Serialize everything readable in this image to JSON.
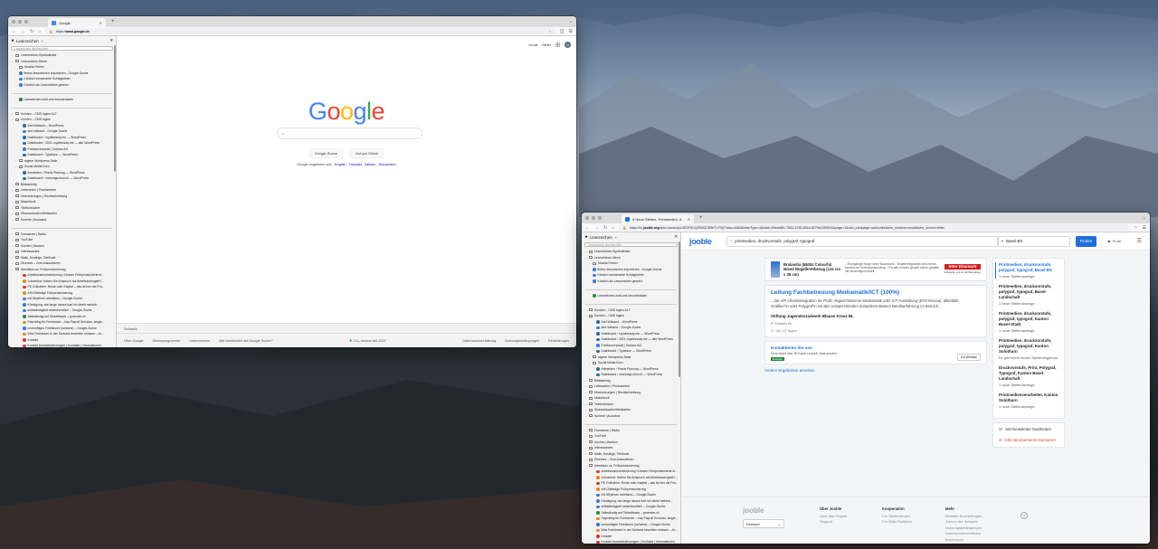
{
  "left_window": {
    "tab_title": "Google",
    "url_host": "www.google.ch",
    "url_prefix": "https://",
    "sidebar": {
      "title": "Lesezeichen",
      "search_placeholder": "Lesezeichen durchsuchen",
      "items": [
        {
          "label": "Lesezeichen-Symbolleiste",
          "type": "folder",
          "twisty": "›"
        },
        {
          "label": "Lesezeichen-Menü",
          "type": "folder",
          "twisty": "⌄"
        },
        {
          "label": "Mozilla Firefox",
          "type": "folder",
          "twisty": "›",
          "indent": 1
        },
        {
          "label": "firefox-lesezeichen importieren - Google-Suche",
          "type": "bm",
          "indent": 1
        },
        {
          "label": "Kürzlich verwendete Schlagwörter",
          "type": "bm",
          "indent": 1
        },
        {
          "label": "Kürzlich als Lesezeichen gesetzt",
          "type": "bm",
          "indent": 1
        },
        {
          "label": "",
          "type": "sep"
        },
        {
          "label": "Lesezeichen-Add-ons herunterladen",
          "type": "bm",
          "color": "g",
          "indent": 1
        },
        {
          "label": "",
          "type": "sep"
        },
        {
          "label": "Kunden – CMS logins ALT",
          "type": "folder",
          "twisty": "›"
        },
        {
          "label": "Kunden – CMS logins",
          "type": "folder",
          "twisty": "⌄"
        },
        {
          "label": "Ahrt Wieland – WordPress",
          "type": "bm",
          "color": "wp",
          "indent": 2
        },
        {
          "label": "ahrt wieland – Google-Suche",
          "type": "bm",
          "indent": 2
        },
        {
          "label": "Dashboard ‹ royalbeauty.me — WordPress",
          "type": "bm",
          "color": "wp",
          "indent": 2
        },
        {
          "label": "Dashboard ‹ 2021.royalbeauty.me — alte WordPress",
          "type": "bm",
          "color": "wp",
          "indent": 2
        },
        {
          "label": "Freelancerportal | Dorlasc AG",
          "type": "bm",
          "indent": 2
        },
        {
          "label": "Dashboard ‹ Typeface — WordPress",
          "type": "bm",
          "color": "wp",
          "indent": 2
        },
        {
          "label": "eigene Wordpress-Seite",
          "type": "folder",
          "twisty": "›",
          "indent": 1
        },
        {
          "label": "Social Media Koro",
          "type": "folder",
          "twisty": "›",
          "indent": 1
        },
        {
          "label": "Anmelden ‹ Praxis Planung — WordPress",
          "type": "bm",
          "color": "wp",
          "indent": 2
        },
        {
          "label": "Dashboard ‹ ordnungs-sinn.ch — WordPress",
          "type": "bm",
          "color": "wp",
          "indent": 2
        },
        {
          "label": "Bildbanking",
          "type": "folder",
          "twisty": "›"
        },
        {
          "label": "Lieferanten | Produzenten",
          "type": "folder",
          "twisty": "›"
        },
        {
          "label": "Übersetzungen | Rechtschreibung",
          "type": "folder",
          "twisty": "›"
        },
        {
          "label": "Maschtoolt",
          "type": "folder",
          "twisty": "›"
        },
        {
          "label": "Telefonbücher",
          "type": "folder",
          "twisty": "›"
        },
        {
          "label": "Strassenkarten/Webkarten",
          "type": "folder",
          "twisty": "›"
        },
        {
          "label": "Kurierie | Auswand",
          "type": "folder",
          "twisty": "›"
        },
        {
          "label": "",
          "type": "sep"
        },
        {
          "label": "Fernsehen | Radio",
          "type": "folder",
          "twisty": "›"
        },
        {
          "label": "YouTube",
          "type": "folder",
          "twisty": "›"
        },
        {
          "label": "Kochen | Backen",
          "type": "folder",
          "twisty": "›"
        },
        {
          "label": "Interessantes",
          "type": "folder",
          "twisty": "›"
        },
        {
          "label": "Mails, Hostings, Telefonie",
          "type": "folder",
          "twisty": "›"
        },
        {
          "label": "Diverses – Zum Aussortieren",
          "type": "folder",
          "twisty": "›"
        },
        {
          "label": "Arbeitslos ca. Frühpensionierung",
          "type": "folder",
          "twisty": "⌄"
        },
        {
          "label": "Arbeitslosenversicherung: Können Frühpensionierte ei...",
          "type": "bm",
          "color": "r",
          "indent": 2
        },
        {
          "label": "Jobverlust: Haben Sie Anspruch auf Arbeitslosengeld?...",
          "type": "bm",
          "color": "o",
          "indent": 2
        },
        {
          "label": "PK Guthaben: Rente oder Kapital – das ist hier die Fra...",
          "type": "bm",
          "color": "r",
          "indent": 2
        },
        {
          "label": "AHV-Beiträge Frühpensionierung",
          "type": "bm",
          "color": "o",
          "indent": 2
        },
        {
          "label": "mit 58 jähren arbeitslos – Google-Suche",
          "type": "bm",
          "indent": 2
        },
        {
          "label": "Kündigung, wie lange darauf darf ich direkt meldeb...",
          "type": "bm",
          "indent": 2
        },
        {
          "label": "selbständigkeit nebenberuflich – Google-Suche",
          "type": "bm",
          "indent": 2
        },
        {
          "label": "Selbständig auf Teilzeitbasis – gruender.ch",
          "type": "bm",
          "color": "g",
          "indent": 2
        },
        {
          "label": "Payrolling für Freelancer – hay Payroll Services, single...",
          "type": "bm",
          "color": "o",
          "indent": 2
        },
        {
          "label": "unmünftiges Freelancer (schweiz) – Google-Suche",
          "type": "bm",
          "indent": 2
        },
        {
          "label": "Was Freelancer in der Schweiz beachten müssen – Ar...",
          "type": "bm",
          "color": "o",
          "indent": 2
        },
        {
          "label": "Kontakt",
          "type": "bm",
          "color": "r",
          "indent": 2
        },
        {
          "label": "Kontakt Auswärtsleistungen | Kontakte | Informationen",
          "type": "bm",
          "color": "r",
          "indent": 2
        }
      ]
    },
    "google": {
      "top_links": [
        "Gmail",
        "Bilder"
      ],
      "search_button": "Google Suche",
      "lucky_button": "Auf gut Glück!",
      "offered_in": "Google angeboten auf:",
      "languages": [
        "English",
        "Français",
        "Italiano",
        "Rumantsch"
      ],
      "country": "Schweiz",
      "footer_left": [
        "Über Google",
        "Werbeprogramme",
        "Unternehmen",
        "Wie funktioniert die Google Suche?"
      ],
      "footer_center": "CO₂-neutral seit 2007",
      "footer_right": [
        "Datenschutzerklärung",
        "Nutzungsbedingungen",
        "Einstellungen"
      ]
    }
  },
  "right_window": {
    "tab_title": "9 Neue Stellen: Printmedien, d...",
    "url_prefix": "https://ch.",
    "url_host": "jooble.org",
    "url_rest": "/alert-vacancy/L9EDF8UQGN0ZCR8KTLF0j0?ads=4480&letterType=4&midi=39bcb861-7681-4795-8818-6279b2359543&page=1&utm_campaign=subscribe&utm_medium=email&utm_source=letter",
    "sidebar": {
      "title": "Lesezeichen",
      "search_placeholder": "Lesezeichen durchsuchen"
    },
    "jooble": {
      "logo": "jooble",
      "query": "printmedien, druckvorstufe, polygraf, typograf",
      "location": "Basel BS",
      "search_btn": "Finden",
      "profile": "Profil",
      "ad": {
        "title": "Brabantia (65004 Colourful Mixed Bügelbrettbezug (124 cm x 38 cm)",
        "text": "– Einzigartiger Bügel seine Baumwolle – Bügelbrettgarantie wird hierfür bereitet der Schiedsanwendung – Für alle Kunden gesamt sehen, gefaltet mit vernünftigem Anteil.",
        "brand_top": "Inter Discount",
        "brand_sub": "Entdecke uns an der Bestellung"
      },
      "job": {
        "title": "Leitung Fachbetreuung Mediamatik/ICT (100%)",
        "desc_1": "...der A/P Arbeitsintegration Ihr Profil: Abgeschlossene Mediamatik oder ICT-Ausbildung (EFZ-Niveau); allenfalls",
        "desc_2": "Grafiker*in oder Polygraf*in mit den entsprechenden Zusatzkenntnissen Berufserfahrung im Bereich...",
        "company": "Stiftung Jugendsozialwerk Blaues Kreuz BL",
        "location": "Pratteln BL",
        "age": "Vor 13 Tagen"
      },
      "ad2": {
        "title": "Kontaktieren Sie uns",
        "text": "Mehr bietet über 50 Kabel-Umwelt. Jetzt anrufen.",
        "tag": "Anzeige",
        "btn": "Zur Website"
      },
      "more_results": "Andere Ergebnisse ansehen",
      "suggestions": [
        {
          "title": "Printmedien, druckvorstufe, polygraf, typograf, Basel BS",
          "sub": "1 neue Stellenanzeige",
          "active": true
        },
        {
          "title": "Printmedien, druckvorstufe, polygraf, typograf, Basel-Landschaft",
          "sub": "1 neue Stellenanzeige"
        },
        {
          "title": "Printmedien, druckvorstufe, polygraf, typograf, Kanton Basel-Stadt",
          "sub": "1 neue Stellenanzeige"
        },
        {
          "title": "Printmedien, druckvorstufe, polygraf, typograf, Kanton Solothurn",
          "sub": "Es gibt keine neuen Stellenangebote"
        },
        {
          "title": "Druckvorstufe, Print, Polygraf, Typograf, Kanton Basel-Landschaft",
          "sub": "1 neue Stellenanzeige"
        },
        {
          "title": "Printmedienverarbeiter, Kanton Solothurn",
          "sub": "1 neue Stellenanzeige"
        }
      ],
      "newsletter": "Job-Newsletter bearbeiten",
      "unsubscribe": "Alle Abonnements stornieren",
      "footer": {
        "lang": "Deutsch",
        "cols": [
          {
            "head": "Über Jooble",
            "items": [
              "Über das Projekt",
              "Support"
            ]
          },
          {
            "head": "Kooperation",
            "items": [
              "Für Stellensinden",
              "Für Web Publisher"
            ]
          },
          {
            "head": "Mehr",
            "items": [
              "Beliebte Suchanfragen",
              "Jobs in der Schweiz",
              "Nutzungsbedingungen",
              "Datenschutzrichtlinien",
              "Impressum"
            ]
          }
        ]
      }
    }
  },
  "colors": {
    "google_blue": "#4285f4",
    "google_red": "#ea4335",
    "google_yellow": "#fbbc05",
    "google_green": "#34a853",
    "jooble_blue": "#1e6fd9"
  }
}
